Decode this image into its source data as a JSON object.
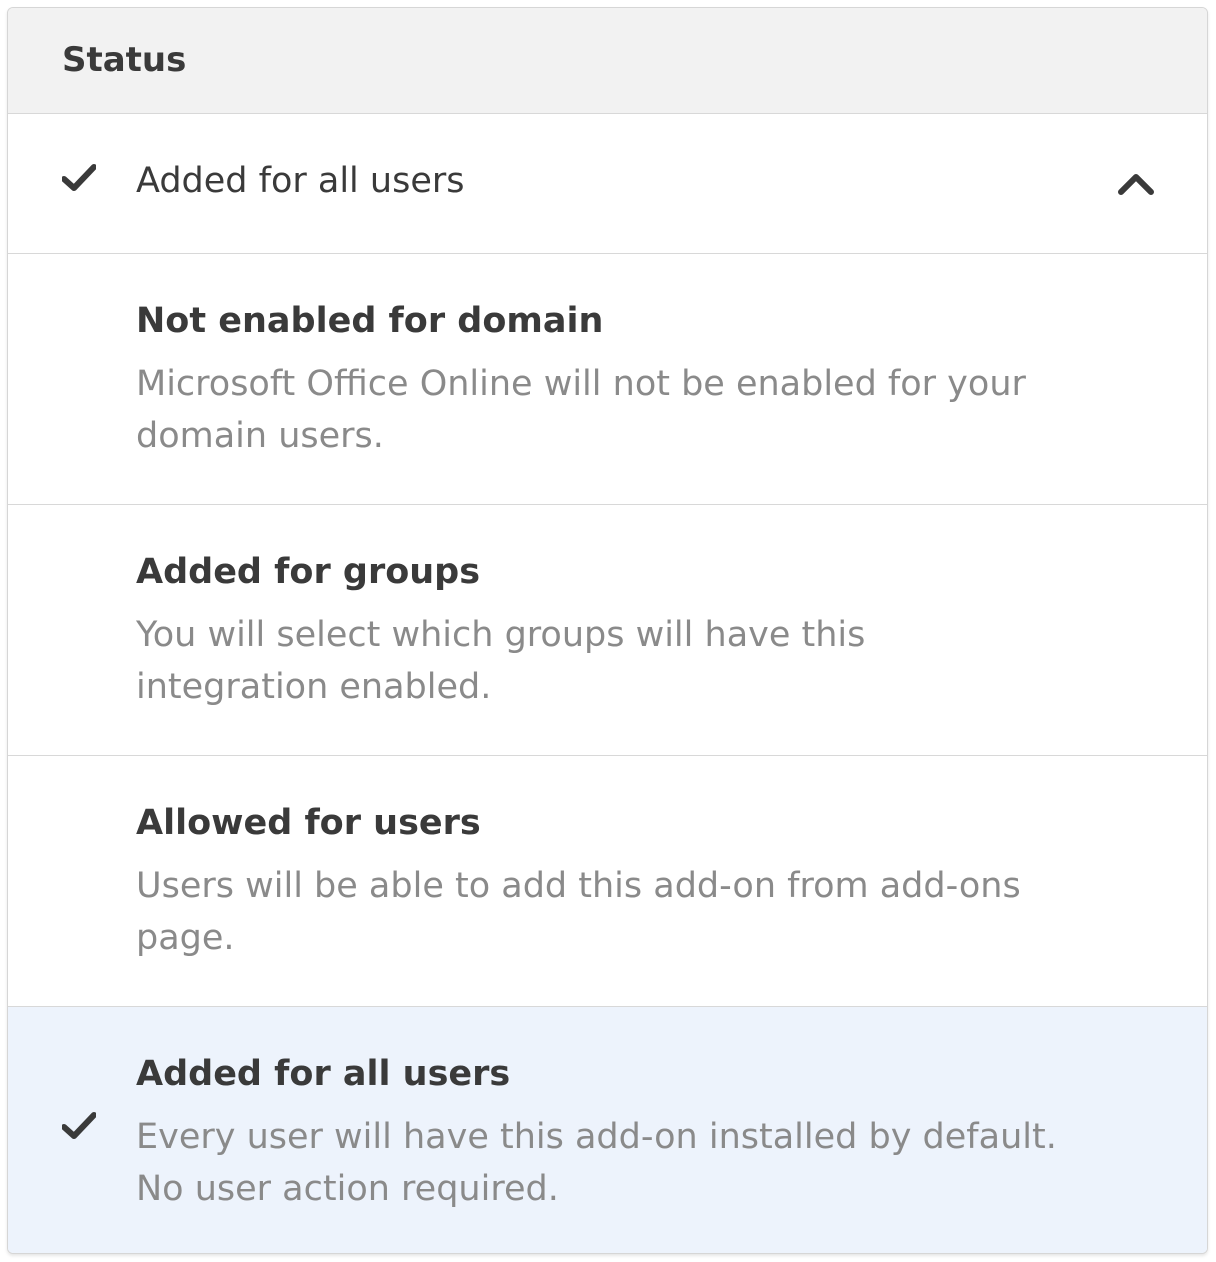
{
  "header": {
    "title": "Status"
  },
  "selected": {
    "label": "Added for all users",
    "check_icon": "check-icon",
    "expand_icon": "chevron-up-icon"
  },
  "options": [
    {
      "title": "Not enabled for domain",
      "description": "Microsoft Office Online will not be enabled for your domain users.",
      "selected": false
    },
    {
      "title": "Added for groups",
      "description": "You will select which groups will have this integration enabled.",
      "selected": false
    },
    {
      "title": "Allowed for users",
      "description": "Users will be able to add this add-on from add-ons page.",
      "selected": false
    },
    {
      "title": "Added for all users",
      "description": "Every user will have this add-on installed by default. No user action required.",
      "selected": true
    }
  ],
  "colors": {
    "header_bg": "#f2f2f2",
    "selected_option_bg": "#edf3fc",
    "title_text": "#3a3a3a",
    "description_text": "#8a8a8a",
    "border": "#d8d8d8"
  }
}
